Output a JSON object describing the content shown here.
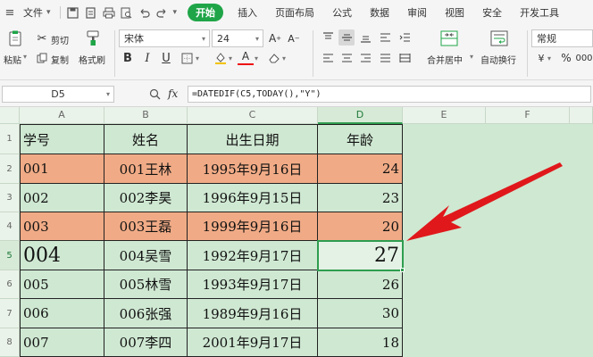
{
  "menubar": {
    "file_label": "文件",
    "tabs": [
      "开始",
      "插入",
      "页面布局",
      "公式",
      "数据",
      "审阅",
      "视图",
      "安全",
      "开发工具"
    ],
    "active_tab": "开始"
  },
  "ribbon": {
    "paste_label": "粘贴",
    "cut_label": "剪切",
    "copy_label": "复制",
    "format_painter_label": "格式刷",
    "font_name": "宋体",
    "font_size": "24",
    "merge_center_label": "合并居中",
    "wrap_text_label": "自动换行",
    "number_format": "常规"
  },
  "formula_bar": {
    "name_box": "D5",
    "fx_label": "fx",
    "formula": "=DATEDIF(C5,TODAY(),\"Y\")"
  },
  "columns": [
    "A",
    "B",
    "C",
    "D",
    "E",
    "F"
  ],
  "rows": [
    "1",
    "2",
    "3",
    "4",
    "5",
    "6",
    "7",
    "8"
  ],
  "selected_cell": "D5",
  "table": {
    "headers": [
      "学号",
      "姓名",
      "出生日期",
      "年龄"
    ],
    "records": [
      {
        "id": "001",
        "name": "001王林",
        "birth": "1995年9月16日",
        "age": "24",
        "highlight": true
      },
      {
        "id": "002",
        "name": "002李昊",
        "birth": "1996年9月15日",
        "age": "23",
        "highlight": false
      },
      {
        "id": "003",
        "name": "003王磊",
        "birth": "1999年9月16日",
        "age": "20",
        "highlight": true
      },
      {
        "id": "004",
        "name": "004吴雪",
        "birth": "1992年9月17日",
        "age": "27",
        "highlight": false
      },
      {
        "id": "005",
        "name": "005林雪",
        "birth": "1993年9月17日",
        "age": "26",
        "highlight": false
      },
      {
        "id": "006",
        "name": "006张强",
        "birth": "1989年9月16日",
        "age": "30",
        "highlight": false
      },
      {
        "id": "007",
        "name": "007李四",
        "birth": "2001年9月17日",
        "age": "18",
        "highlight": false
      }
    ]
  },
  "colors": {
    "accent": "#1fa548",
    "sheet_bg": "#cfe8d2",
    "highlight_row": "#f0ab86",
    "arrow": "#e0181b"
  }
}
